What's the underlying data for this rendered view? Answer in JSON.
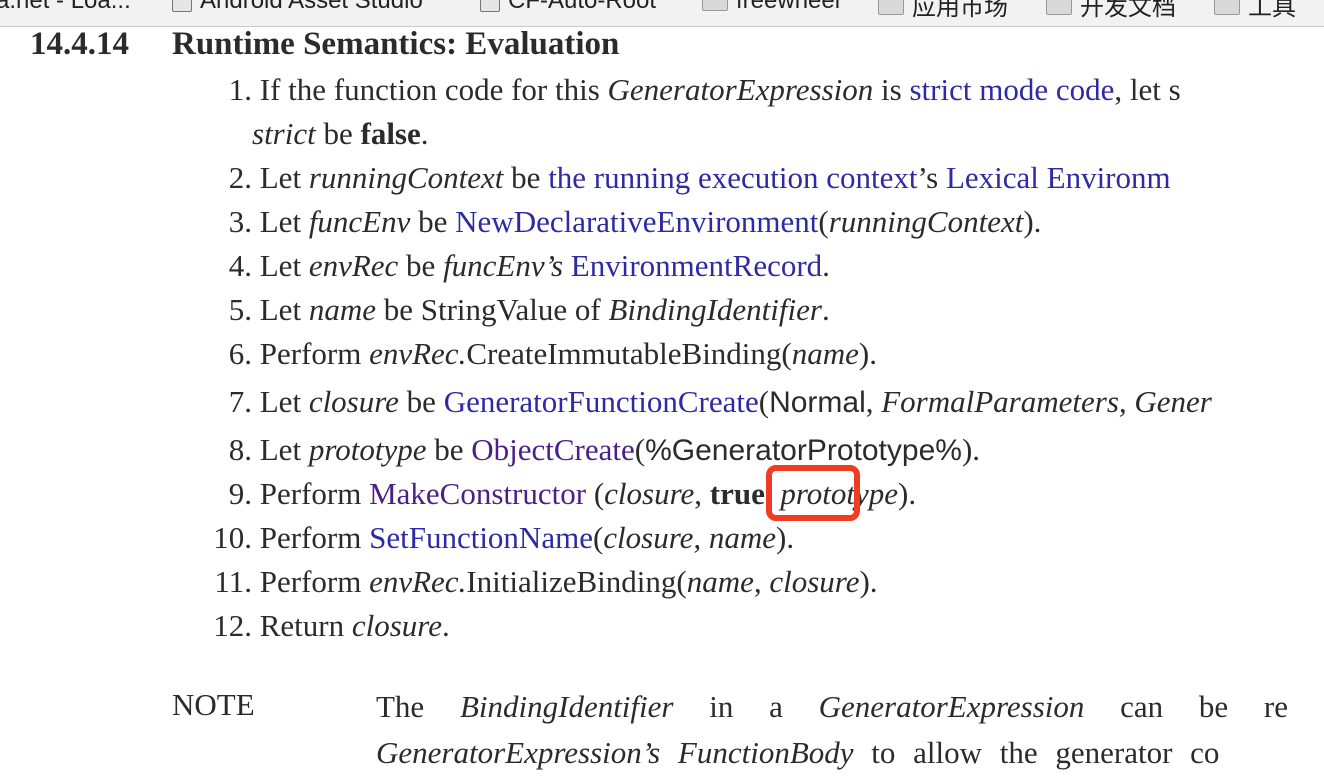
{
  "bookmarks_bar": {
    "items": [
      {
        "label": "a.net - Loa...",
        "icon": "page-icon"
      },
      {
        "label": "Android Asset Studio",
        "icon": "page-icon"
      },
      {
        "label": "CF-Auto-Root",
        "icon": "page-icon"
      },
      {
        "label": "freewheel",
        "icon": "folder-icon"
      },
      {
        "label": "应用市场",
        "icon": "folder-icon"
      },
      {
        "label": "开发文档",
        "icon": "folder-icon"
      },
      {
        "label": "工具",
        "icon": "folder-icon"
      }
    ]
  },
  "section": {
    "number": "14.4.14",
    "title": "Runtime Semantics: Evaluation"
  },
  "steps": [
    {
      "num": "1.",
      "parts": [
        "If the function code for this ",
        "GeneratorExpression",
        " is ",
        "strict mode code",
        ", let s"
      ],
      "cont": [
        "strict",
        " be ",
        "false",
        "."
      ]
    },
    {
      "num": "2.",
      "parts": [
        "Let ",
        "runningContext",
        " be ",
        "the running execution context",
        "’s ",
        "Lexical Environm"
      ]
    },
    {
      "num": "3.",
      "parts": [
        "Let ",
        "funcEnv",
        " be ",
        "NewDeclarativeEnvironment",
        "(",
        "runningContext",
        ")."
      ]
    },
    {
      "num": "4.",
      "parts": [
        "Let ",
        "envRec",
        " be ",
        "funcEnv’s",
        " ",
        "EnvironmentRecord",
        "."
      ]
    },
    {
      "num": "5.",
      "parts": [
        "Let ",
        "name",
        " be StringValue of ",
        "BindingIdentifier",
        "."
      ]
    },
    {
      "num": "6.",
      "parts": [
        "Perform ",
        "envRec.",
        "CreateImmutableBinding(",
        "name",
        ")."
      ]
    },
    {
      "num": "7.",
      "parts": [
        "Let ",
        "closure",
        " be ",
        "GeneratorFunctionCreate",
        "(",
        "Normal",
        ", ",
        "FormalParameters, Gener"
      ]
    },
    {
      "num": "8.",
      "parts": [
        "Let ",
        "prototype",
        " be ",
        "ObjectCreate",
        "(",
        "%GeneratorPrototype%",
        ")."
      ]
    },
    {
      "num": "9.",
      "parts": [
        "Perform ",
        "MakeConstructor",
        " (",
        "closure",
        ", ",
        "true",
        ", ",
        "prototype",
        ")."
      ]
    },
    {
      "num": "10.",
      "parts": [
        "Perform ",
        "SetFunctionName",
        "(",
        "closure, name",
        ")."
      ]
    },
    {
      "num": "11.",
      "parts": [
        "Perform ",
        "envRec.",
        "InitializeBinding(",
        "name, closure",
        ")."
      ]
    },
    {
      "num": "12.",
      "parts": [
        "Return ",
        "closure",
        "."
      ]
    }
  ],
  "note": {
    "label": "NOTE",
    "line1": [
      "The ",
      "BindingIdentifier",
      " in a ",
      "GeneratorExpression",
      " can be re"
    ],
    "line2": [
      "GeneratorExpression’s FunctionBody",
      " to allow the generator co"
    ]
  },
  "colors": {
    "link": "#2d2aa3",
    "visited_link": "#4b1f86",
    "highlight_box": "#f03c22",
    "text": "#2b2b2b"
  }
}
